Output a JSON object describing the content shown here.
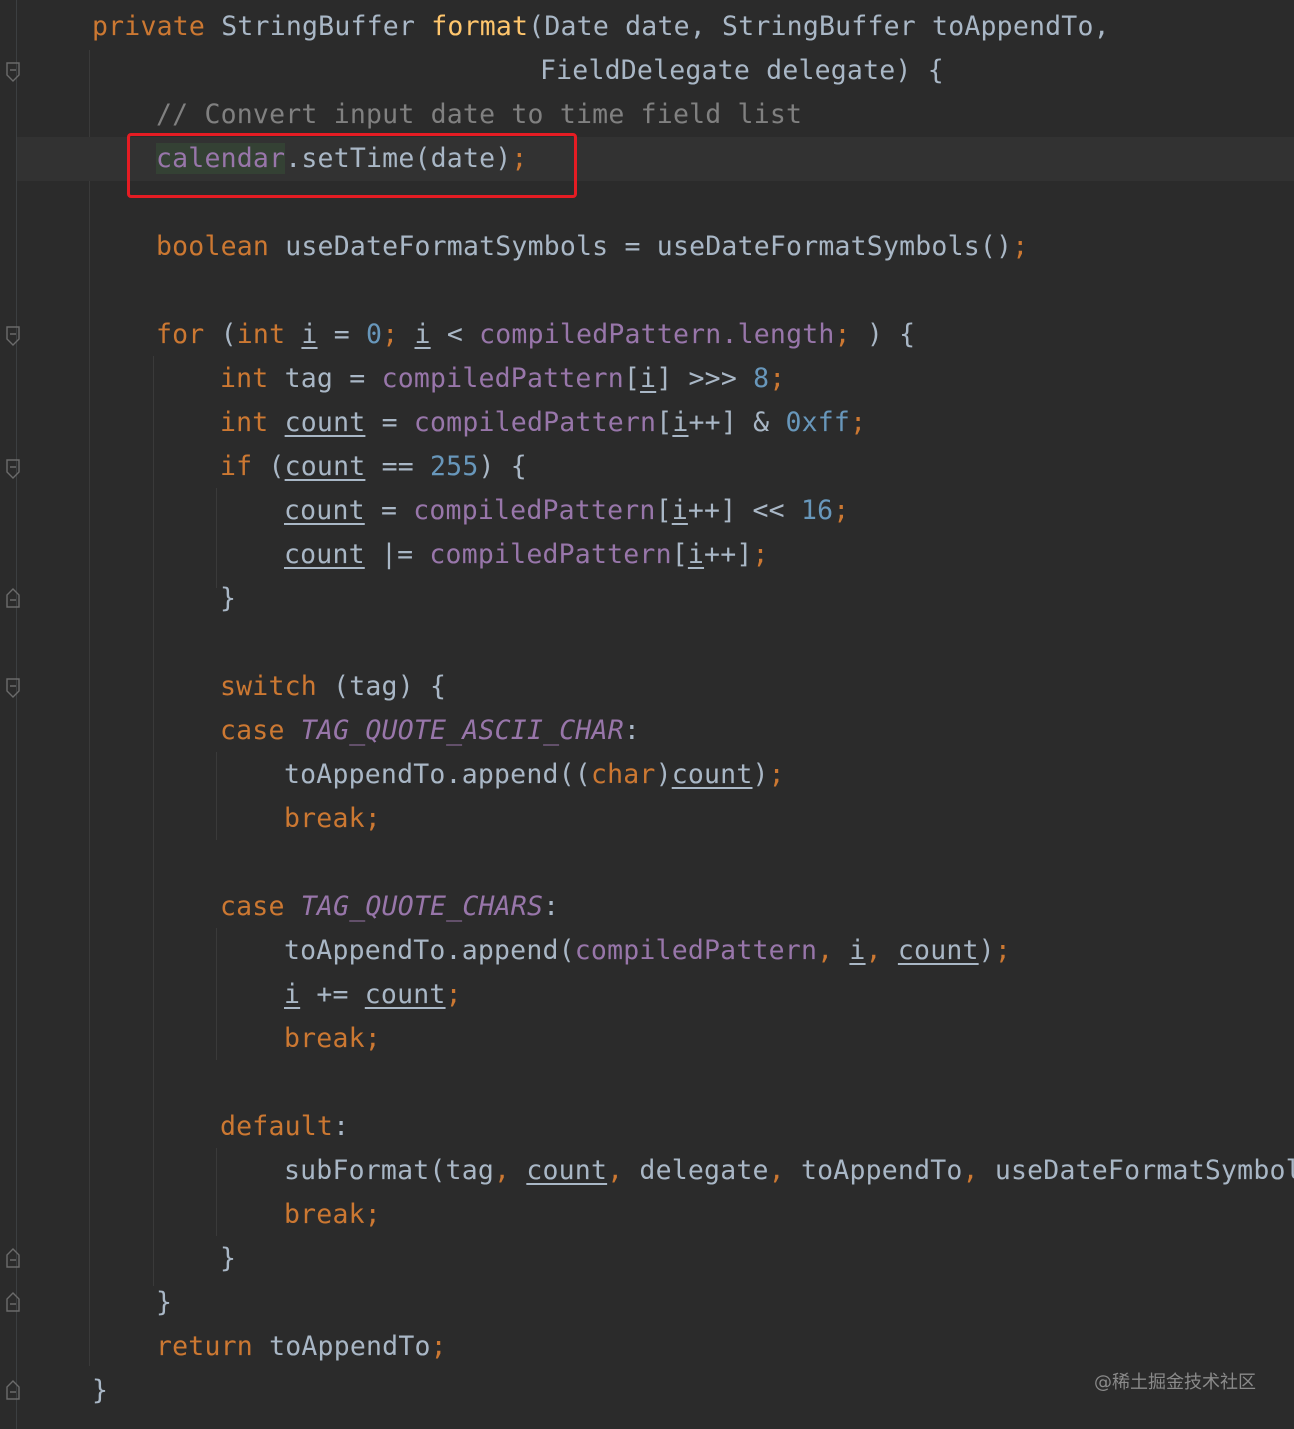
{
  "editor": {
    "language": "Java",
    "colors": {
      "background": "#2b2b2b",
      "keyword": "#cc7832",
      "method_decl": "#ffc66d",
      "comment": "#808080",
      "number": "#6897bb",
      "field": "#9876aa",
      "plain": "#a9b7c6",
      "highlight_box": "#e51c23"
    },
    "code": {
      "l1": {
        "kw": "private",
        "type": "StringBuffer",
        "name": "format",
        "rest": "(Date date, StringBuffer toAppendTo,"
      },
      "l2": {
        "rest": "FieldDelegate delegate) {"
      },
      "l3": {
        "comment": "// Convert input date to time field list"
      },
      "l4": {
        "field": "calendar",
        "rest": ".setTime(date)",
        "semi": ";"
      },
      "l5": {
        "kw": "boolean",
        "rest": "useDateFormatSymbols = useDateFormatSymbols()",
        "semi": ";"
      },
      "l6": {
        "kw_for": "for",
        "p1": "(",
        "kw_int": "int",
        "var_i": "i",
        "eq": "=",
        "zero": "0",
        "semi1": ";",
        "lt": "<",
        "fld": "compiledPattern",
        "len": ".length",
        "semi2": ";",
        "end": ") {"
      },
      "l7": {
        "kw": "int",
        "name": "tag",
        "eq": "=",
        "fld": "compiledPattern",
        "idx": "i",
        "op": ">>>",
        "num": "8",
        "semi": ";"
      },
      "l8": {
        "kw": "int",
        "name": "count",
        "eq": "=",
        "fld": "compiledPattern",
        "idx": "i",
        "inc": "++]",
        "op": "&",
        "num": "0xff",
        "semi": ";"
      },
      "l9": {
        "kw": "if",
        "var": "count",
        "op": "==",
        "num": "255",
        "end": ") {"
      },
      "l10": {
        "var": "count",
        "eq": "=",
        "fld": "compiledPattern",
        "idx": "i",
        "inc": "++]",
        "op": "<<",
        "num": "16",
        "semi": ";"
      },
      "l11": {
        "var": "count",
        "op": "|=",
        "fld": "compiledPattern",
        "idx": "i",
        "inc": "++]",
        "semi": ";"
      },
      "l12": {
        "brace": "}"
      },
      "l13": {
        "kw": "switch",
        "rest": "(tag) {"
      },
      "l14": {
        "kw": "case",
        "const": "TAG_QUOTE_ASCII_CHAR",
        "colon": ":"
      },
      "l15": {
        "pre": "toAppendTo.append((",
        "kw": "char",
        "close": ")",
        "var": "count",
        "end": ")",
        "semi": ";"
      },
      "l16": {
        "kw": "break",
        "semi": ";"
      },
      "l17": {
        "kw": "case",
        "const": "TAG_QUOTE_CHARS",
        "colon": ":"
      },
      "l18": {
        "pre": "toAppendTo.append(",
        "fld": "compiledPattern",
        "c1": ",",
        "i": "i",
        "c2": ",",
        "var": "count",
        "end": ")",
        "semi": ";"
      },
      "l19": {
        "i": "i",
        "op": "+=",
        "var": "count",
        "semi": ";"
      },
      "l20": {
        "kw": "break",
        "semi": ";"
      },
      "l21": {
        "kw": "default",
        "colon": ":"
      },
      "l22": {
        "pre": "subFormat(tag",
        "c1": ",",
        "var": "count",
        "c2": ",",
        "d": "delegate",
        "c3": ",",
        "t": "toAppendTo",
        "c4": ",",
        "u": "useDateFormatSymbol"
      },
      "l23": {
        "kw": "break",
        "semi": ";"
      },
      "l24": {
        "brace": "}"
      },
      "l25": {
        "brace": "}"
      },
      "l26": {
        "kw": "return",
        "rest": "toAppendTo",
        "semi": ";"
      },
      "l27": {
        "brace": "}"
      }
    }
  },
  "watermark": "@稀土掘金技术社区"
}
